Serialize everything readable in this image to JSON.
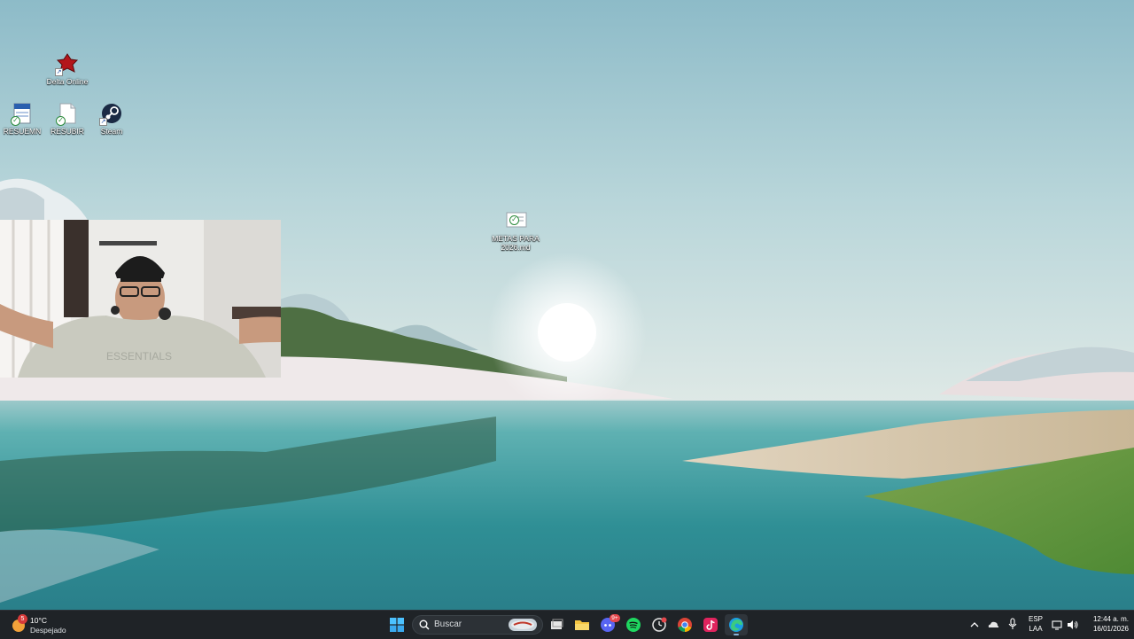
{
  "desktop": {
    "icons": [
      {
        "label": "Delta Online"
      },
      {
        "label": "RESUEMN"
      },
      {
        "label": "RESUBIR"
      },
      {
        "label": "Steam"
      },
      {
        "label": "METAS PARA 2026.md"
      }
    ]
  },
  "webcam_overlay": {
    "shirt_text": "ESSENTIALS"
  },
  "taskbar": {
    "weather": {
      "temperature": "10°C",
      "condition": "Despejado",
      "badge": "5"
    },
    "search": {
      "placeholder": "Buscar"
    },
    "apps": [
      {
        "name": "start-icon"
      },
      {
        "name": "task-view-icon"
      },
      {
        "name": "file-explorer-icon"
      },
      {
        "name": "discord-icon",
        "badge": "9+"
      },
      {
        "name": "spotify-icon"
      },
      {
        "name": "clock-app-icon"
      },
      {
        "name": "chrome-icon"
      },
      {
        "name": "tiktok-icon"
      },
      {
        "name": "edge-icon",
        "active": true
      }
    ],
    "tray": {
      "language_line1": "ESP",
      "language_line2": "LAA",
      "time": "12:44 a. m.",
      "date": "16/01/2026"
    }
  },
  "colors": {
    "taskbar_bg": "#1f2327",
    "accent": "#8ab4d8",
    "sky_top": "#8dbbc8",
    "water": "#2f8f95"
  }
}
